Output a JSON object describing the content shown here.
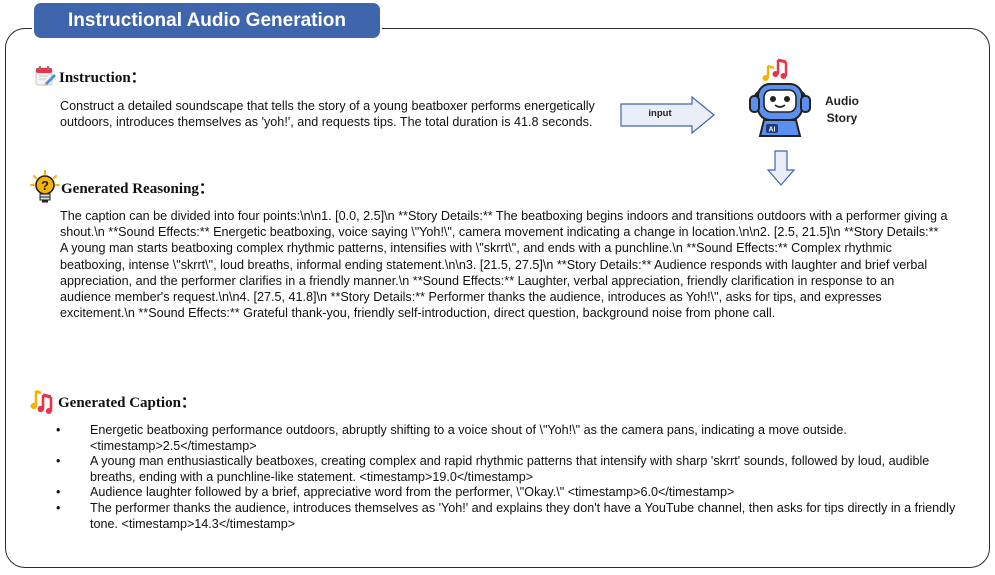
{
  "header": {
    "title": "Instructional Audio Generation"
  },
  "instruction": {
    "heading": "Instruction：",
    "text": "Construct a detailed soundscape that tells the story of a young beatboxer performs energetically outdoors, introduces themselves as 'yoh!', and requests tips. The total duration is 41.8 seconds."
  },
  "flow": {
    "arrow_label": "input",
    "output_label_line1": "Audio",
    "output_label_line2": "Story"
  },
  "reasoning": {
    "heading": "Generated Reasoning：",
    "text": "The caption can be divided into four points:\\n\\n1. [0.0, 2.5]\\n **Story Details:** The beatboxing begins indoors and transitions outdoors with a performer giving a shout.\\n **Sound Effects:** Energetic beatboxing, voice saying \\\"Yoh!\\\", camera movement indicating a change in location.\\n\\n2. [2.5, 21.5]\\n **Story Details:** A young man starts beatboxing complex rhythmic patterns, intensifies with \\\"skrrt\\\", and ends with a punchline.\\n **Sound Effects:** Complex rhythmic beatboxing, intense \\\"skrrt\\\", loud breaths, informal ending statement.\\n\\n3. [21.5, 27.5]\\n **Story Details:** Audience responds with laughter and brief verbal appreciation, and the performer clarifies in a friendly manner.\\n **Sound Effects:** Laughter, verbal appreciation, friendly clarification in response to an audience member's request.\\n\\n4. [27.5, 41.8]\\n **Story Details:** Performer thanks the audience, introduces as Yoh!\\\", asks for tips, and expresses excitement.\\n **Sound Effects:** Grateful thank-you, friendly self-introduction, direct question, background noise from phone call."
  },
  "caption": {
    "heading": "Generated Caption：",
    "bullet": "•",
    "items": [
      "Energetic beatboxing performance outdoors, abruptly shifting to a voice shout of \\\"Yoh!\\\" as the camera pans, indicating a move outside. <timestamp>2.5</timestamp>",
      "A young man enthusiastically beatboxes, creating complex and rapid rhythmic patterns that intensify with sharp 'skrrt' sounds, followed by loud, audible breaths, ending with a punchline-like statement. <timestamp>19.0</timestamp>",
      "Audience laughter followed by a brief, appreciative word from the performer, \\\"Okay.\\\" <timestamp>6.0</timestamp>",
      "The performer thanks the audience, introduces themselves as 'Yoh!' and explains they don't have a YouTube channel, then asks for tips directly in a friendly tone. <timestamp>14.3</timestamp>"
    ]
  },
  "icons": {
    "instruction": "calendar-pencil-icon",
    "reasoning": "lightbulb-question-icon",
    "caption": "music-note-icon",
    "robot": "robot-headphones-icon",
    "robot_badge": "AI"
  },
  "colors": {
    "title_bg": "#3f66ad",
    "arrow_fill": "#e9eef8",
    "arrow_stroke": "#3f66ad",
    "robot_blue": "#5b8ff0",
    "music_red": "#e8334a",
    "music_yellow": "#f5b400"
  }
}
